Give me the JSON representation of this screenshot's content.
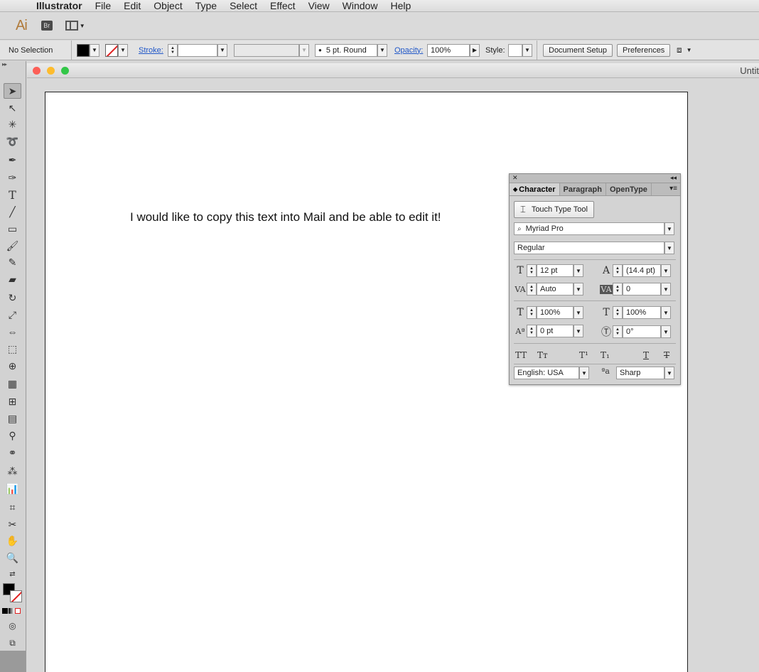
{
  "menubar": {
    "app_name": "Illustrator",
    "items": [
      "File",
      "Edit",
      "Object",
      "Type",
      "Select",
      "Effect",
      "View",
      "Window",
      "Help"
    ]
  },
  "appbar": {
    "ai_logo": "Ai",
    "br_logo": "Br"
  },
  "controlbar": {
    "selection_label": "No Selection",
    "stroke_label": "Stroke:",
    "brush_value": "5 pt. Round",
    "opacity_label": "Opacity:",
    "opacity_value": "100%",
    "style_label": "Style:",
    "document_setup": "Document Setup",
    "preferences": "Preferences"
  },
  "document": {
    "title": "Untit",
    "canvas_text": "I would like to copy this text into Mail and be able to edit it!"
  },
  "character_panel": {
    "tabs": [
      "Character",
      "Paragraph",
      "OpenType"
    ],
    "touch_type_button": "Touch Type Tool",
    "font_family": "Myriad Pro",
    "font_style": "Regular",
    "font_size": "12 pt",
    "leading": "(14.4 pt)",
    "kerning": "Auto",
    "tracking": "0",
    "vertical_scale": "100%",
    "horizontal_scale": "100%",
    "baseline_shift": "0 pt",
    "rotation": "0°",
    "language": "English: USA",
    "antialias": "Sharp"
  },
  "colors": {
    "fill": "#000000",
    "link": "#2057c8",
    "close_light": "#fc5f57",
    "minimize_light": "#fdbc2e",
    "zoom_light": "#33c748"
  }
}
